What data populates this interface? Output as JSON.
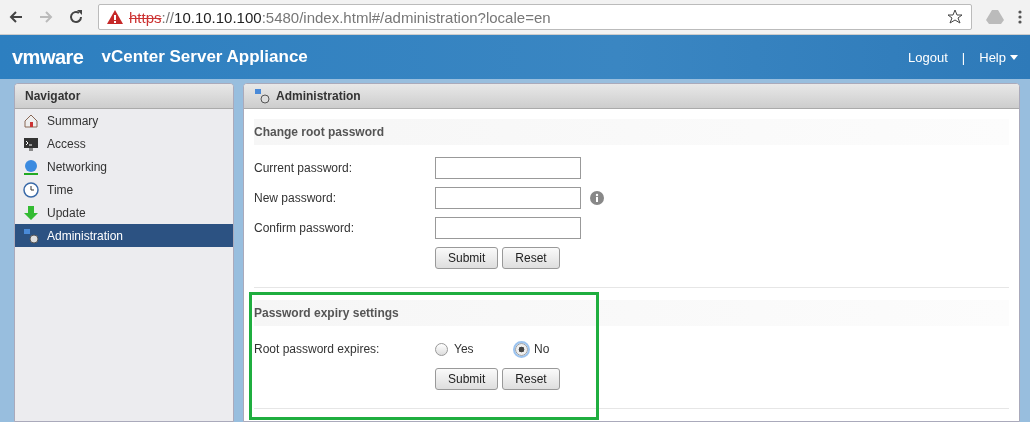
{
  "browser": {
    "url": {
      "scheme": "https",
      "separator": "://",
      "host": "10.10.10.100",
      "rest": ":5480/index.html#/administration?locale=en"
    }
  },
  "header": {
    "brand": "vmware",
    "title": "vCenter Server Appliance",
    "links": [
      "Logout",
      "|",
      "Help"
    ]
  },
  "navigator": {
    "title": "Navigator",
    "items": [
      {
        "label": "Summary",
        "selected": false
      },
      {
        "label": "Access",
        "selected": false
      },
      {
        "label": "Networking",
        "selected": false
      },
      {
        "label": "Time",
        "selected": false
      },
      {
        "label": "Update",
        "selected": false
      },
      {
        "label": "Administration",
        "selected": true
      }
    ]
  },
  "content": {
    "title": "Administration",
    "sections": [
      {
        "title": "Change root password",
        "rows": [
          {
            "kind": "field",
            "label": "Current password:",
            "info": false
          },
          {
            "kind": "field",
            "label": "New password:",
            "info": true
          },
          {
            "kind": "field",
            "label": "Confirm password:",
            "info": false
          }
        ],
        "buttons": [
          "Submit",
          "Reset"
        ],
        "highlighted": false
      },
      {
        "title": "Password expiry settings",
        "rows": [
          {
            "kind": "radio",
            "label": "Root password expires:",
            "options": [
              {
                "label": "Yes",
                "selected": false
              },
              {
                "label": "No",
                "selected": true
              }
            ]
          }
        ],
        "buttons": [
          "Submit",
          "Reset"
        ],
        "highlighted": true
      }
    ]
  }
}
